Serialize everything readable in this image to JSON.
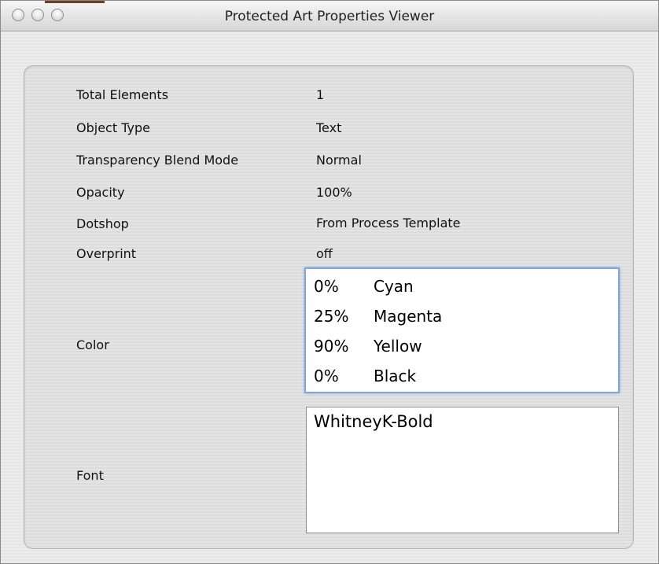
{
  "window": {
    "title": "Protected Art Properties Viewer"
  },
  "properties": [
    {
      "label": "Total Elements",
      "value": "1"
    },
    {
      "label": "Object Type",
      "value": "Text"
    },
    {
      "label": "Transparency Blend Mode",
      "value": "Normal"
    },
    {
      "label": "Opacity",
      "value": "100%"
    },
    {
      "label": "Dotshop",
      "value": "From Process Template"
    },
    {
      "label": "Overprint",
      "value": "off"
    }
  ],
  "color": {
    "label": "Color",
    "entries": [
      {
        "percent": "0%",
        "name": "Cyan"
      },
      {
        "percent": "25%",
        "name": "Magenta"
      },
      {
        "percent": "90%",
        "name": "Yellow"
      },
      {
        "percent": "0%",
        "name": "Black"
      }
    ]
  },
  "font": {
    "label": "Font",
    "value": "WhitneyK-Bold"
  }
}
